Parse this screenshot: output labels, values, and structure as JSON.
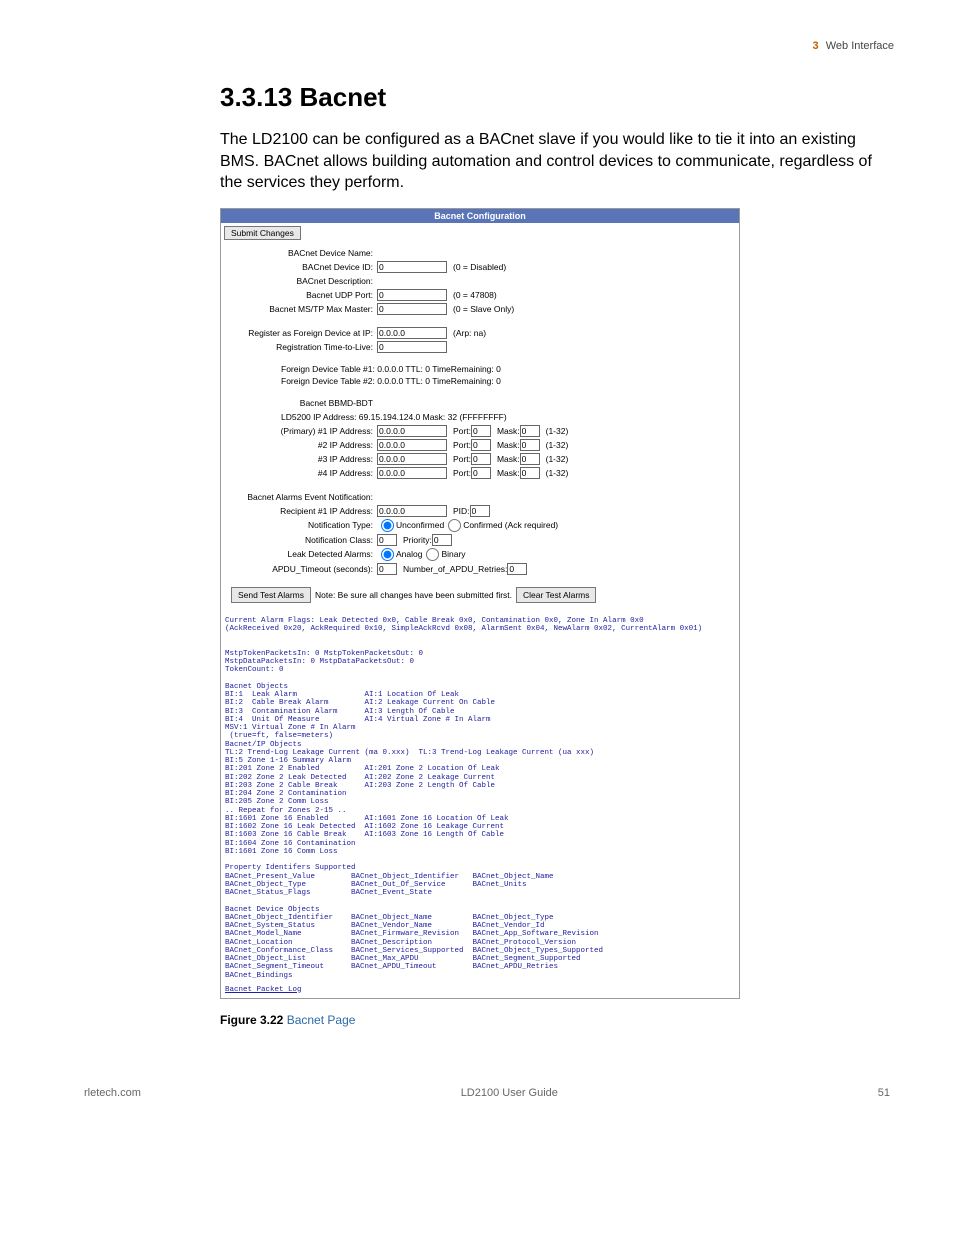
{
  "header": {
    "chapter": "3",
    "section": "Web Interface"
  },
  "title": "3.3.13 Bacnet",
  "intro": "The LD2100 can be configured as a BACnet slave if you would like to tie it into an existing BMS. BACnet allows building automation and control devices to communicate, regardless of the services they perform.",
  "screenshot": {
    "title_bar": "Bacnet Configuration",
    "submit": "Submit Changes",
    "rows": {
      "device_name_lbl": "BACnet Device Name:",
      "device_id_lbl": "BACnet Device ID:",
      "device_id_val": "0",
      "device_id_hint": "(0 = Disabled)",
      "description_lbl": "BACnet Description:",
      "udp_port_lbl": "Bacnet UDP Port:",
      "udp_port_val": "0",
      "udp_port_hint": "(0 = 47808)",
      "mstp_lbl": "Bacnet MS/TP Max Master:",
      "mstp_val": "0",
      "mstp_hint": "(0 = Slave Only)",
      "reg_foreign_lbl": "Register as Foreign Device at IP:",
      "reg_foreign_val": "0.0.0.0",
      "reg_foreign_hint": "(Arp: na)",
      "reg_ttl_lbl": "Registration Time-to-Live:",
      "reg_ttl_val": "0",
      "fd1": "Foreign Device Table #1: 0.0.0.0 TTL: 0 TimeRemaining: 0",
      "fd2": "Foreign Device Table #2: 0.0.0.0 TTL: 0 TimeRemaining: 0",
      "bbmd_hdr": "Bacnet BBMD-BDT",
      "ld5200": "LD5200 IP Address: 69.15.194.124.0 Mask: 32 (FFFFFFFF)",
      "primary_lbl": "(Primary) #1 IP Address:",
      "ip_val": "0.0.0.0",
      "ip2_lbl": "#2 IP Address:",
      "ip3_lbl": "#3 IP Address:",
      "ip4_lbl": "#4 IP Address:",
      "port_lbl": "Port:",
      "port_val": "0",
      "mask_lbl": "Mask:",
      "mask_val": "0",
      "mask_hint": "(1-32)",
      "alarms_hdr": "Bacnet Alarms Event Notification:",
      "recipient_lbl": "Recipient #1 IP Address:",
      "recipient_val": "0.0.0.0",
      "pid_lbl": "PID:",
      "pid_val": "0",
      "notif_type_lbl": "Notification Type:",
      "unconfirmed": "Unconfirmed",
      "confirmed": "Confirmed (Ack required)",
      "notif_class_lbl": "Notification Class:",
      "notif_class_val": "0",
      "priority_lbl": "Priority:",
      "priority_val": "0",
      "leak_lbl": "Leak Detected Alarms:",
      "analog": "Analog",
      "binary": "Binary",
      "apdu_lbl": "APDU_Timeout (seconds):",
      "apdu_val": "0",
      "apdu_retries_lbl": "Number_of_APDU_Retries:",
      "apdu_retries_val": "0",
      "send_test": "Send Test Alarms",
      "note": "Note: Be sure all changes have been submitted first.",
      "clear_test": "Clear Test Alarms"
    },
    "diag": "Current Alarm Flags: Leak Detected 0x0, Cable Break 0x0, Contamination 0x0, Zone In Alarm 0x0\n(AckReceived 0x20, AckRequired 0x10, SimpleAckRcvd 0x08, AlarmSent 0x04, NewAlarm 0x02, CurrentAlarm 0x01)\n\n\nMstpTokenPacketsIn: 0 MstpTokenPacketsOut: 0\nMstpDataPacketsIn: 0 MstpDataPacketsOut: 0\nTokenCount: 0\n\nBacnet Objects\nBI:1  Leak Alarm               AI:1 Location Of Leak\nBI:2  Cable Break Alarm        AI:2 Leakage Current On Cable\nBI:3  Contamination Alarm      AI:3 Length Of Cable\nBI:4  Unit Of Measure          AI:4 Virtual Zone # In Alarm\nMSV:1 Virtual Zone # In Alarm\n (true=ft, false=meters)\nBacnet/IP Objects\nTL:2 Trend-Log Leakage Current (ma 0.xxx)  TL:3 Trend-Log Leakage Current (ua xxx)\nBI:5 Zone 1-16 Summary Alarm\nBI:201 Zone 2 Enabled          AI:201 Zone 2 Location Of Leak\nBI:202 Zone 2 Leak Detected    AI:202 Zone 2 Leakage Current\nBI:203 Zone 2 Cable Break      AI:203 Zone 2 Length Of Cable\nBI:204 Zone 2 Contamination\nBI:205 Zone 2 Comm Loss\n.. Repeat for Zones 2-15 ..\nBI:1601 Zone 16 Enabled        AI:1601 Zone 16 Location Of Leak\nBI:1602 Zone 16 Leak Detected  AI:1602 Zone 16 Leakage Current\nBI:1603 Zone 16 Cable Break    AI:1603 Zone 16 Length Of Cable\nBI:1604 Zone 16 Contamination\nBI:1601 Zone 16 Comm Loss\n\nProperty Identifers Supported\nBACnet_Present_Value        BACnet_Object_Identifier   BACnet_Object_Name\nBACnet_Object_Type          BACnet_Out_Of_Service      BACnet_Units\nBACnet_Status_Flags         BACnet_Event_State\n\nBacnet Device Objects\nBACnet_Object_Identifier    BACnet_Object_Name         BACnet_Object_Type\nBACnet_System_Status        BACnet_Vendor_Name         BACnet_Vendor_Id\nBACnet_Model_Name           BACnet_Firmware_Revision   BACnet_App_Software_Revision\nBACnet_Location             BACnet_Description         BACnet_Protocol_Version\nBACnet_Conformance_Class    BACnet_Services_Supported  BACnet_Object_Types_Supported\nBACnet_Object_List          BACnet_Max_APDU            BACnet_Segment_Supported\nBACnet_Segment_Timeout      BACnet_APDU_Timeout        BACnet_APDU_Retries\nBACnet_Bindings",
    "packet_log": "Bacnet Packet Log"
  },
  "figure": {
    "label": "Figure 3.22",
    "caption": "Bacnet Page"
  },
  "footer": {
    "left": "rletech.com",
    "center": "LD2100 User Guide",
    "right": "51"
  }
}
